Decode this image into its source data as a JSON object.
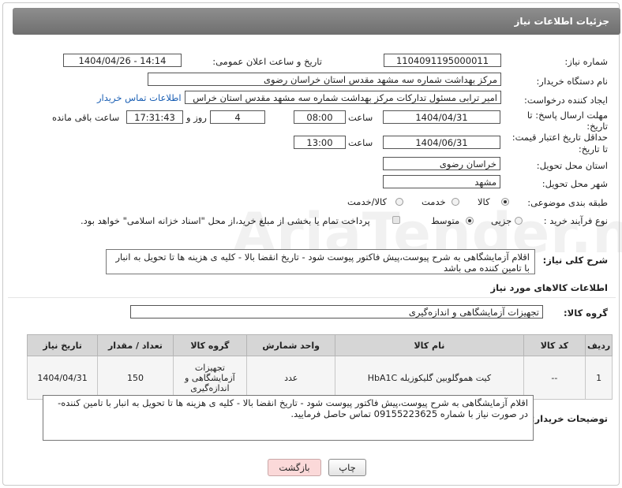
{
  "header": {
    "title": "جزئیات اطلاعات نیاز"
  },
  "fields": {
    "need_number_label": "شماره نیاز:",
    "need_number": "1104091195000011",
    "announce_label": "تاریخ و ساعت اعلان عمومی:",
    "announce_value": "1404/04/26 - 14:14",
    "buyer_label": "نام دستگاه خریدار:",
    "buyer_value": "مرکز بهداشت شماره سه مشهد مقدس استان خراسان رضوی",
    "creator_label": "ایجاد کننده درخواست:",
    "creator_value": "امیر ترابی مسئول تدارکات مرکز بهداشت شماره سه مشهد مقدس استان خراس",
    "contact_link": "اطلاعات تماس خریدار",
    "deadline_label_1": "مهلت ارسال پاسخ: تا",
    "deadline_label_2": "تاریخ:",
    "deadline_date": "1404/04/31",
    "time_label": "ساعت",
    "deadline_time": "08:00",
    "days_value": "4",
    "days_label": "روز و",
    "remaining_time": "17:31:43",
    "remaining_label": "ساعت باقی مانده",
    "price_label_1": "حداقل تاریخ اعتبار قیمت:",
    "price_label_2": "تا تاریخ:",
    "price_date": "1404/06/31",
    "price_time": "13:00",
    "province_label": "استان محل تحویل:",
    "province_value": "خراسان رضوی",
    "city_label": "شهر محل تحویل:",
    "city_value": "مشهد",
    "category_label": "طبقه بندی موضوعی:",
    "category_options": [
      "کالا",
      "خدمت",
      "کالا/خدمت"
    ],
    "process_label": "نوع فرآیند خرید :",
    "process_options": [
      "جزیی",
      "متوسط"
    ],
    "payment_note": "پرداخت تمام یا بخشی از مبلغ خرید،از محل \"اسناد خزانه اسلامی\" خواهد بود.",
    "general_desc_label": "شرح کلی نیاز:",
    "general_desc": "اقلام آزمایشگاهی به شرح پیوست،پیش فاکتور پیوست شود - تاریخ انقضا بالا - کلیه ی هزینه ها تا تحویل به انبار با تامین کننده می باشد",
    "goods_info_title": "اطلاعات کالاهای مورد نیاز",
    "goods_group_label": "گروه کالا:",
    "goods_group_value": "تجهیزات آزمایشگاهی و اندازه‌گیری"
  },
  "table": {
    "headers": [
      "ردیف",
      "کد کالا",
      "نام کالا",
      "واحد شمارش",
      "گروه کالا",
      "تعداد / مقدار",
      "تاریخ نیاز"
    ],
    "row": {
      "index": "1",
      "code": "--",
      "name": "کیت هموگلوبین گلیکوزیله HbA1C",
      "unit": "عدد",
      "group": "تجهیزات آزمایشگاهی و اندازه‌گیری",
      "qty": "150",
      "date": "1404/04/31"
    }
  },
  "buyer_notes_label": "توضیحات خریدار:",
  "buyer_notes": "اقلام آزمایشگاهی به شرح پیوست،پیش فاکتور پیوست شود - تاریخ انقضا بالا - کلیه ی هزینه ها تا تحویل به انبار با تامین کننده- در صورت نیاز با شماره 09155223625 تماس حاصل فرمایید.",
  "buttons": {
    "print": "چاپ",
    "back": "بازگشت"
  },
  "watermark": "AriaTender.neT"
}
